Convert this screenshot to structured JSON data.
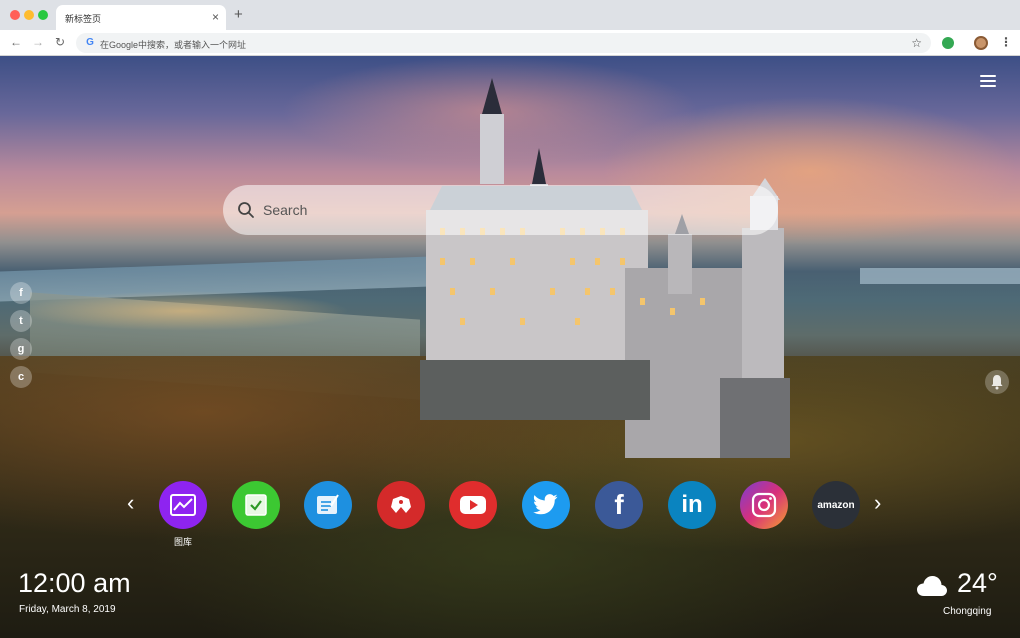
{
  "browser": {
    "tab_title": "新标签页",
    "tab_close": "×",
    "new_tab": "+",
    "omnibox_placeholder": "在Google中搜索，或者输入一个网址",
    "nav": {
      "back": "←",
      "forward": "→",
      "reload": "↻"
    },
    "star": "☆",
    "menu": "⋮"
  },
  "page": {
    "search": {
      "placeholder": "Search"
    },
    "shortcuts": [
      {
        "name": "gallery",
        "label": "图库",
        "color": "#8e24f0"
      },
      {
        "name": "tasks",
        "label": "",
        "color": "#3cc832"
      },
      {
        "name": "notes",
        "label": "",
        "color": "#1e90e0"
      },
      {
        "name": "games",
        "label": "",
        "color": "#d42a2a"
      },
      {
        "name": "youtube",
        "label": "",
        "color": "#e02d2d"
      },
      {
        "name": "twitter",
        "label": "",
        "color": "#1d9bf0"
      },
      {
        "name": "facebook",
        "label": "",
        "color": "#3b5998"
      },
      {
        "name": "linkedin",
        "label": "",
        "color": "#0a84c0"
      },
      {
        "name": "instagram",
        "label": "",
        "color": "#d8307a"
      },
      {
        "name": "amazon",
        "label": "amazon",
        "color": "#2b3038"
      }
    ],
    "side_social": [
      {
        "icon": "facebook-icon",
        "glyph": "f"
      },
      {
        "icon": "twitter-icon",
        "glyph": "t"
      },
      {
        "icon": "google-icon",
        "glyph": "g"
      },
      {
        "icon": "chat-icon",
        "glyph": "c"
      }
    ],
    "arrows": {
      "left": "‹",
      "right": "›"
    },
    "clock": {
      "time": "12:00 am",
      "date": "Friday, March 8, 2019"
    },
    "weather": {
      "temp": "24°",
      "city": "Chongqing"
    }
  }
}
